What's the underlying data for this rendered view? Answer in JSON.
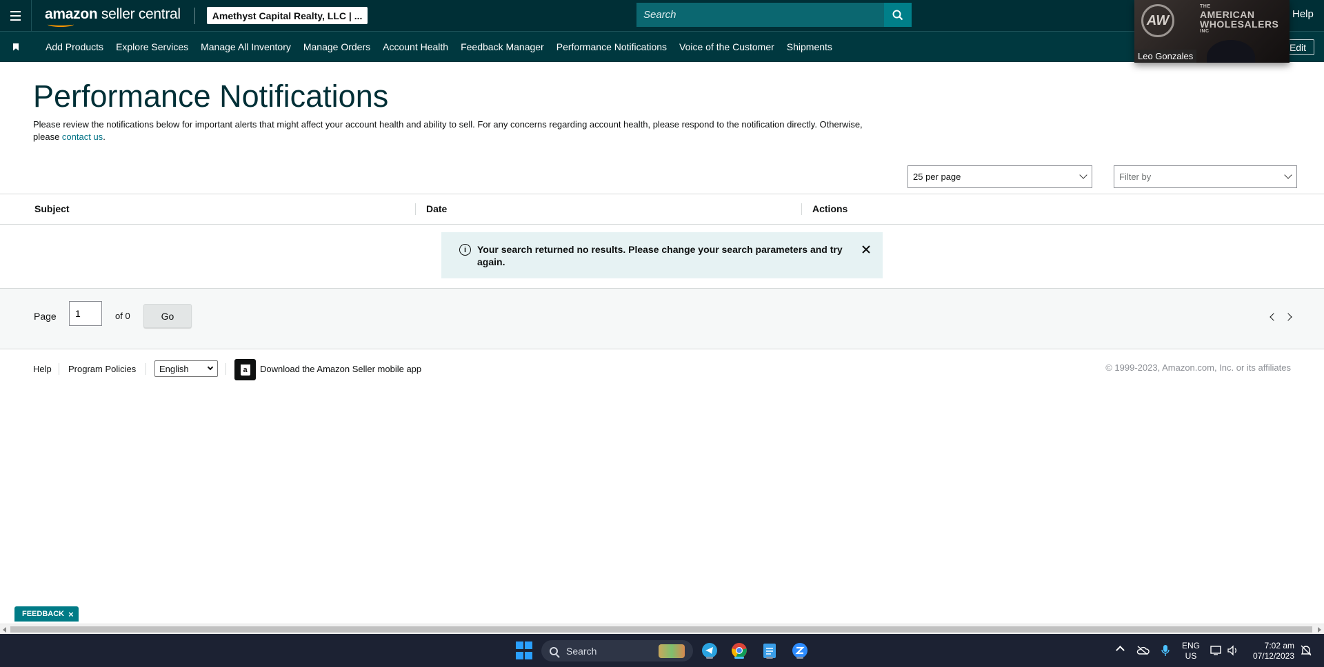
{
  "header": {
    "logo_text_bold": "amazon",
    "logo_text_rest": " seller central",
    "account": "Amethyst Capital Realty, LLC | ...",
    "search_placeholder": "Search",
    "help": "Help"
  },
  "nav": {
    "items": [
      "Add Products",
      "Explore Services",
      "Manage All Inventory",
      "Manage Orders",
      "Account Health",
      "Feedback Manager",
      "Performance Notifications",
      "Voice of the Customer",
      "Shipments"
    ],
    "edit": "Edit"
  },
  "video": {
    "logo_letters": "AW",
    "brand_small": "THE",
    "brand_line1": "AMERICAN",
    "brand_line2": "WHOLESALERS",
    "brand_line3": "INC",
    "participant": "Leo Gonzales"
  },
  "main": {
    "title": "Performance Notifications",
    "description": "Please review the notifications below for important alerts that might affect your account health and ability to sell. For any concerns regarding account health, please respond to the notification directly. Otherwise, please ",
    "contact_link": "contact us",
    "description_end": ".",
    "per_page": "25 per page",
    "filter_placeholder": "Filter by",
    "columns": [
      "Subject",
      "Date",
      "Actions"
    ],
    "empty_message": "Your search returned no results. Please change your search parameters and try again."
  },
  "pager": {
    "page_label": "Page",
    "page_value": "1",
    "of_label": "of 0",
    "go": "Go"
  },
  "footer": {
    "help": "Help",
    "policies": "Program Policies",
    "language": "English",
    "app_link": "Download the Amazon Seller mobile app",
    "copyright": "© 1999-2023, Amazon.com, Inc. or its affiliates"
  },
  "feedback_tab": "FEEDBACK",
  "taskbar": {
    "search": "Search",
    "lang_line1": "ENG",
    "lang_line2": "US",
    "time": "7:02 am",
    "date": "07/12/2023"
  },
  "colors": {
    "header_bg": "#002f36",
    "nav_bg": "#00383f",
    "accent": "#007185",
    "alert_bg": "#e6f2f3",
    "feedback_bg": "#007b86"
  }
}
